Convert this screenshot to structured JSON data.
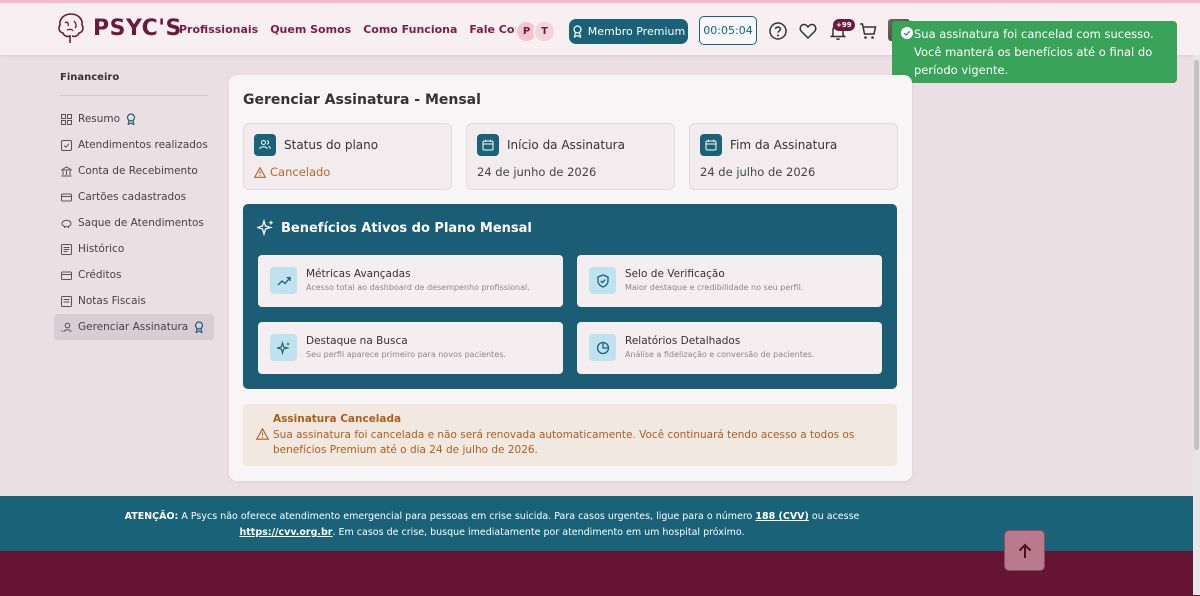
{
  "header": {
    "logo_text": "PSYC'S",
    "nav": [
      {
        "label": "Profissionais"
      },
      {
        "label": "Quem Somos"
      },
      {
        "label": "Como Funciona"
      },
      {
        "label": "Fale Conosco"
      }
    ],
    "avatars": [
      "P",
      "T"
    ],
    "premium_label": "Membro Premium",
    "timer": "00:05:04",
    "notification_count": "+99"
  },
  "toast": {
    "message": "Sua assinatura foi cancelad com sucesso. Você manterá os benefícios até o final do período vigente."
  },
  "sidebar": {
    "title": "Financeiro",
    "items": [
      {
        "label": "Resumo",
        "icon": "grid-icon"
      },
      {
        "label": "Atendimentos realizados",
        "icon": "check-square-icon"
      },
      {
        "label": "Conta de Recebimento",
        "icon": "bank-icon"
      },
      {
        "label": "Cartões cadastrados",
        "icon": "card-icon"
      },
      {
        "label": "Saque de Atendimentos",
        "icon": "piggy-icon"
      },
      {
        "label": "Histórico",
        "icon": "list-icon"
      },
      {
        "label": "Créditos",
        "icon": "wallet-icon"
      },
      {
        "label": "Notas Fiscais",
        "icon": "receipt-icon"
      },
      {
        "label": "Gerenciar Assinatura",
        "icon": "subscription-icon"
      }
    ]
  },
  "main": {
    "title": "Gerenciar Assinatura - Mensal",
    "status": {
      "label": "Status do plano",
      "value": "Cancelado"
    },
    "start": {
      "label": "Início da Assinatura",
      "value": "24 de junho de 2026"
    },
    "end": {
      "label": "Fim da Assinatura",
      "value": "24 de julho de 2026"
    },
    "benefits": {
      "title": "Benefícios Ativos do Plano Mensal",
      "items": [
        {
          "title": "Métricas Avançadas",
          "desc": "Acesso total ao dashboard de desempenho profissional."
        },
        {
          "title": "Selo de Verificação",
          "desc": "Maior destaque e credibilidade no seu perfil."
        },
        {
          "title": "Destaque na Busca",
          "desc": "Seu perfil aparece primeiro para novos pacientes."
        },
        {
          "title": "Relatórios Detalhados",
          "desc": "Análise a fidelização e conversão de pacientes."
        }
      ]
    },
    "cancel_notice": {
      "title": "Assinatura Cancelada",
      "text": "Sua assinatura foi cancelada e não será renovada automaticamente. Você continuará tendo acesso a todos os benefícios Premium até o dia 24 de julho de 2026."
    }
  },
  "footer": {
    "attention_label": "ATENÇÃO:",
    "text_1": " A Psycs não oferece atendimento emergencial para pessoas em crise suicida. Para casos urgentes, ligue para o número ",
    "cvv_number": "188 (CVV)",
    "text_2": " ou acesse ",
    "cvv_link": "https://cvv.org.br",
    "text_3": ". Em casos de crise, busque imediatamente por atendimento em um hospital próximo."
  },
  "colors": {
    "brand": "#6b1b3a",
    "teal": "#1a6278",
    "toast_green": "#3aa35a",
    "warning": "#b05d1f"
  }
}
